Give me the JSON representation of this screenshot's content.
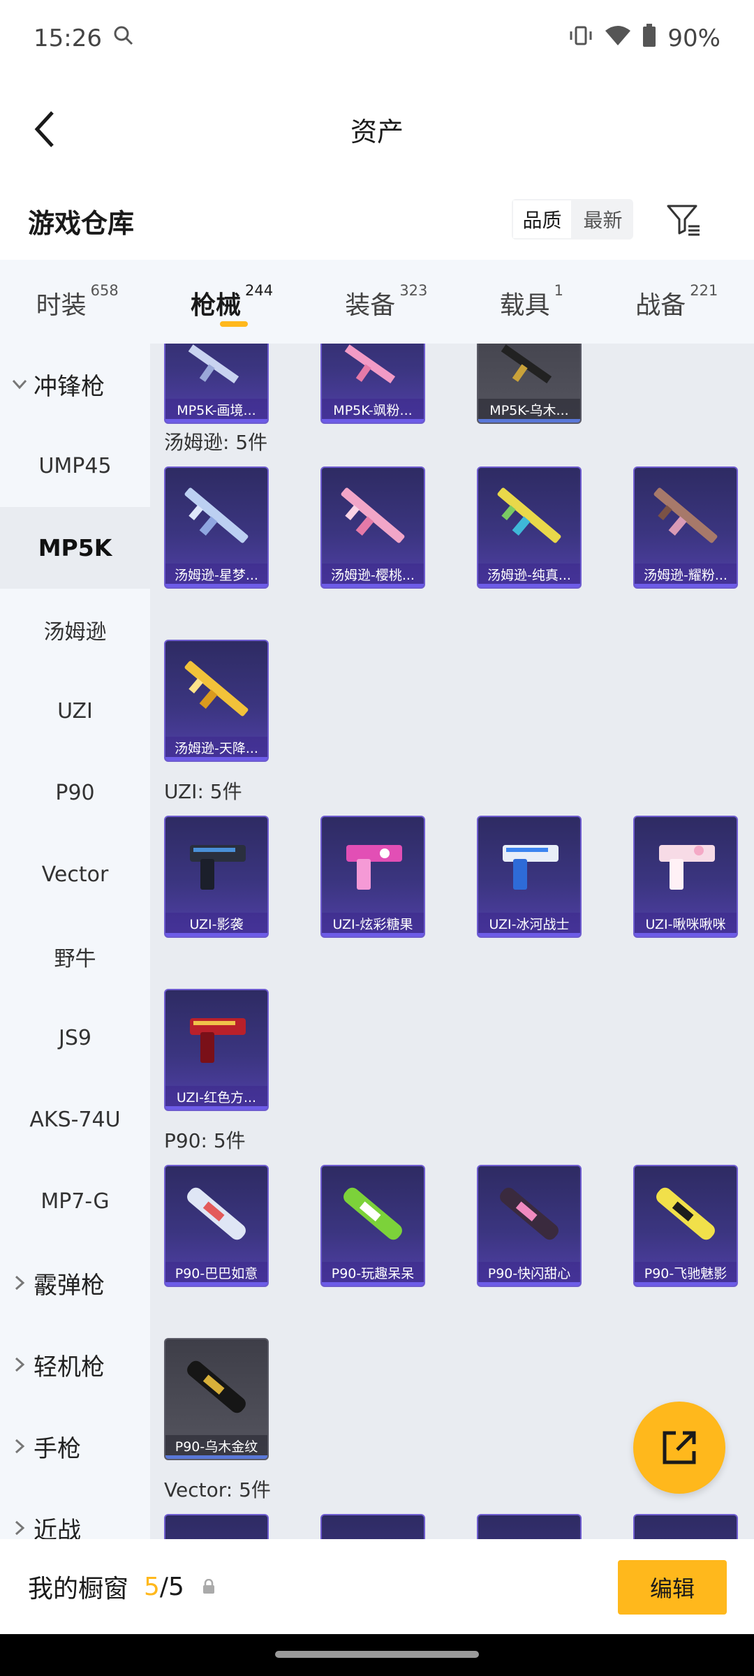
{
  "status_bar": {
    "time": "15:26",
    "battery": "90%",
    "icons": [
      "search-icon",
      "vibrate-icon",
      "wifi-icon",
      "battery-icon"
    ]
  },
  "header": {
    "title": "资产"
  },
  "section": {
    "title": "游戏仓库",
    "sort_options": [
      "品质",
      "最新"
    ],
    "sort_selected": "品质"
  },
  "tabs": [
    {
      "label": "时装",
      "count": "658",
      "active": false
    },
    {
      "label": "枪械",
      "count": "244",
      "active": true
    },
    {
      "label": "装备",
      "count": "323",
      "active": false
    },
    {
      "label": "载具",
      "count": "1",
      "active": false
    },
    {
      "label": "战备",
      "count": "221",
      "active": false
    }
  ],
  "sidebar": {
    "items": [
      {
        "label": "冲锋枪",
        "type": "category",
        "expanded": true
      },
      {
        "label": "UMP45",
        "type": "sub"
      },
      {
        "label": "MP5K",
        "type": "sub",
        "active": true
      },
      {
        "label": "汤姆逊",
        "type": "sub"
      },
      {
        "label": "UZI",
        "type": "sub"
      },
      {
        "label": "P90",
        "type": "sub"
      },
      {
        "label": "Vector",
        "type": "sub"
      },
      {
        "label": "野牛",
        "type": "sub"
      },
      {
        "label": "JS9",
        "type": "sub"
      },
      {
        "label": "AKS-74U",
        "type": "sub"
      },
      {
        "label": "MP7-G",
        "type": "sub"
      },
      {
        "label": "霰弹枪",
        "type": "category",
        "expanded": false
      },
      {
        "label": "轻机枪",
        "type": "category",
        "expanded": false
      },
      {
        "label": "手枪",
        "type": "category",
        "expanded": false
      },
      {
        "label": "近战",
        "type": "category",
        "expanded": false
      }
    ]
  },
  "content": {
    "top_row": [
      "MP5K-画境...",
      "MP5K-飒粉...",
      "MP5K-乌木..."
    ],
    "groups": [
      {
        "title": "汤姆逊: 5件",
        "items": [
          "汤姆逊-星梦...",
          "汤姆逊-樱桃...",
          "汤姆逊-纯真...",
          "汤姆逊-耀粉...",
          "汤姆逊-天降..."
        ]
      },
      {
        "title": "UZI: 5件",
        "items": [
          "UZI-影袭",
          "UZI-炫彩糖果",
          "UZI-冰河战士",
          "UZI-啾咪啾咪",
          "UZI-红色方..."
        ]
      },
      {
        "title": "P90: 5件",
        "items": [
          "P90-巴巴如意",
          "P90-玩趣呆呆",
          "P90-快闪甜心",
          "P90-飞驰魅影",
          "P90-乌木金纹"
        ]
      },
      {
        "title": "Vector: 5件",
        "items": [
          "",
          "",
          "",
          ""
        ]
      }
    ]
  },
  "bottom_bar": {
    "label": "我的橱窗",
    "current": "5",
    "total": "/5",
    "edit_label": "编辑"
  },
  "colors": {
    "accent": "#ffb81c",
    "sidebar_bg": "#f4f7fb",
    "content_bg": "#e9ecf1",
    "card_purple": "#3b3580",
    "card_border": "#6e5ccf"
  }
}
